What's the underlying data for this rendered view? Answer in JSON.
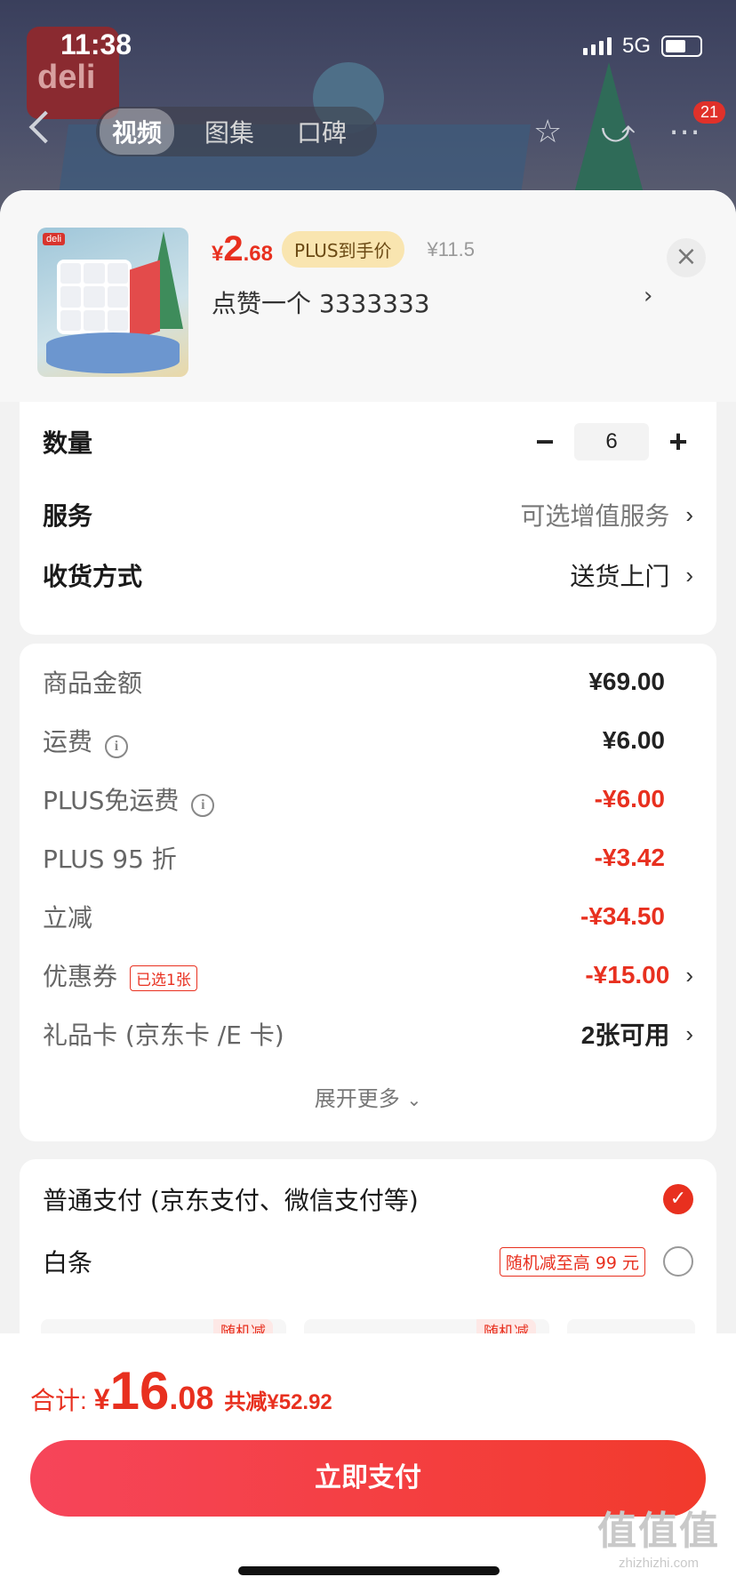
{
  "status": {
    "time": "11:38",
    "network": "5G"
  },
  "nav": {
    "tabs": [
      {
        "label": "视频",
        "active": true
      },
      {
        "label": "图集",
        "active": false
      },
      {
        "label": "口碑",
        "active": false
      }
    ],
    "cart_count": "21"
  },
  "product": {
    "price_currency": "¥",
    "price_int": "2",
    "price_dec": ".68",
    "plus_tag": "PLUS到手价",
    "orig_price": "¥11.5",
    "spec": "点赞一个  3333333",
    "thumb_logo": "deli"
  },
  "options": {
    "quantity_label": "数量",
    "quantity": "6",
    "minus": "−",
    "plus": "+",
    "service_label": "服务",
    "service_value": "可选增值服务",
    "delivery_label": "收货方式",
    "delivery_value": "送货上门"
  },
  "fees": {
    "rows": [
      {
        "label": "商品金额",
        "value": "¥69.00"
      },
      {
        "label": "运费",
        "value": "¥6.00"
      },
      {
        "label": "PLUS免运费",
        "value": "-¥6.00"
      },
      {
        "label": "PLUS 95 折",
        "value": "-¥3.42"
      },
      {
        "label": "立减",
        "value": "-¥34.50"
      },
      {
        "label": "优惠券",
        "value": "-¥15.00",
        "tag": "已选1张"
      },
      {
        "label": "礼品卡 (京东卡 /E 卡)",
        "value": "2张可用"
      }
    ],
    "expand_label": "展开更多"
  },
  "payment": {
    "normal_label": "普通支付 (京东支付、微信支付等)",
    "baitiao_label": "白条",
    "baitiao_promo": "随机减至高 99 元",
    "installment_tag": "随机减"
  },
  "bottom": {
    "total_label": "合计:",
    "total_currency": "¥",
    "total_int": "16",
    "total_dec": ".08",
    "total_saved": "共减¥52.92",
    "pay_button": "立即支付"
  },
  "watermark": {
    "big": "值值值",
    "small": "zhizhizhi.com"
  },
  "colors": {
    "accent": "#e8301f",
    "plus_tag_bg": "#f9e5b0",
    "page_bg": "#f2f2f2"
  }
}
